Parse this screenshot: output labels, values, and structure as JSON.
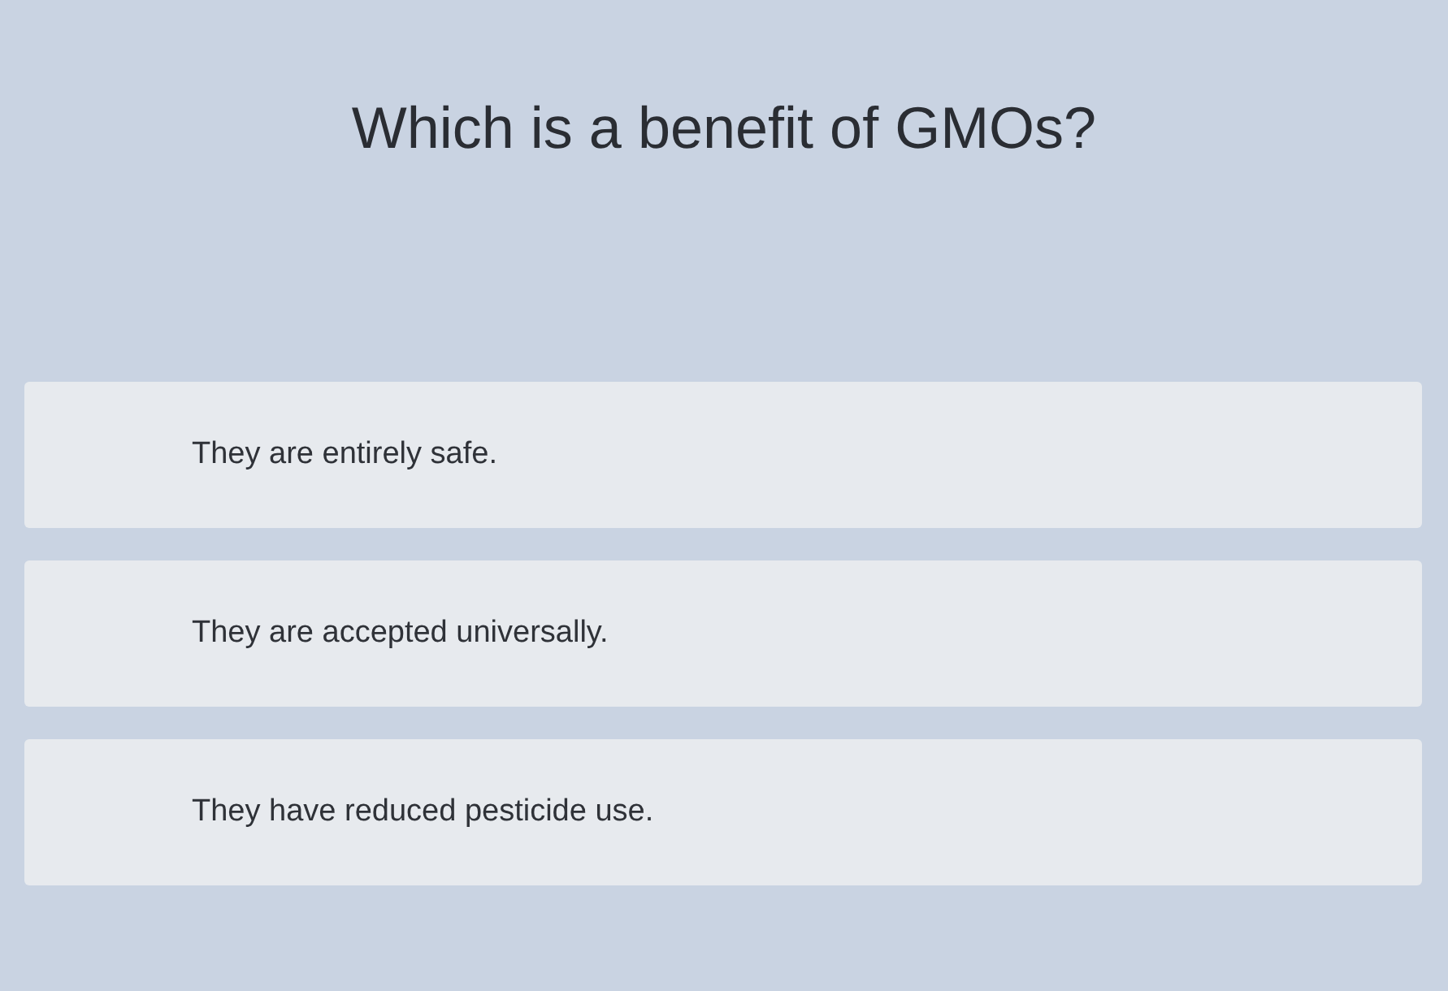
{
  "question": "Which is a benefit of GMOs?",
  "options": [
    {
      "label": "They are entirely safe."
    },
    {
      "label": "They are accepted universally."
    },
    {
      "label": "They have reduced pesticide use."
    }
  ]
}
